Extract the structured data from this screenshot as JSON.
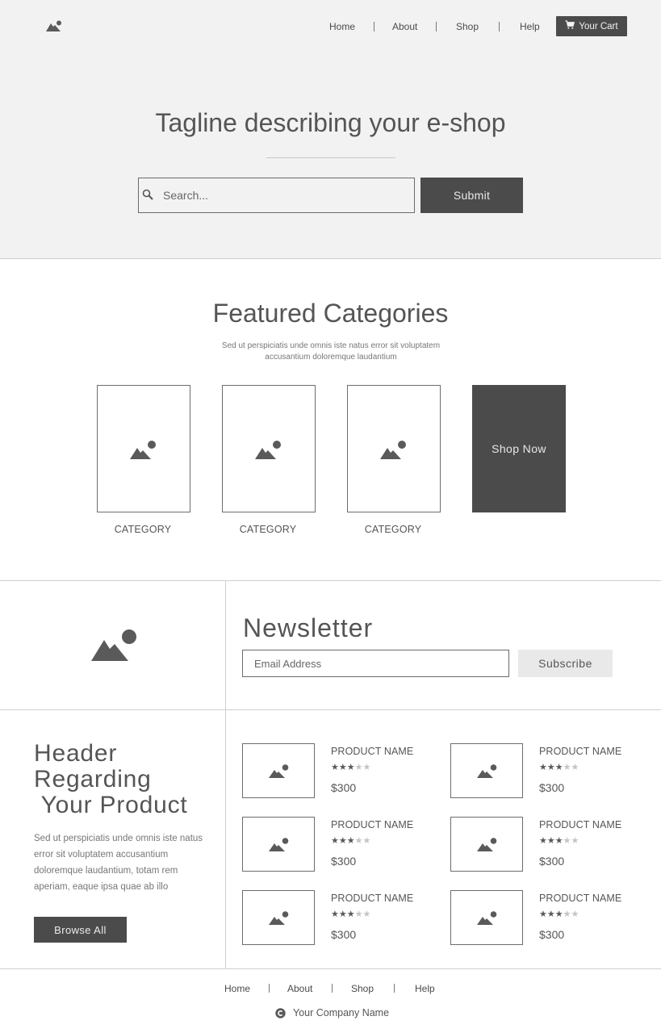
{
  "nav": {
    "items": [
      {
        "label": "Home"
      },
      {
        "label": "About"
      },
      {
        "label": "Shop"
      },
      {
        "label": "Help"
      }
    ],
    "cart_label": "Your Cart"
  },
  "hero": {
    "tagline": "Tagline describing your e-shop",
    "search_placeholder": "Search...",
    "submit_label": "Submit"
  },
  "featured": {
    "title": "Featured Categories",
    "description": "Sed ut perspiciatis unde omnis iste natus error sit voluptatem accusantium doloremque laudantium",
    "categories": [
      {
        "label": "CATEGORY"
      },
      {
        "label": "CATEGORY"
      },
      {
        "label": "CATEGORY"
      }
    ],
    "shop_now_label": "Shop Now"
  },
  "newsletter": {
    "title": "Newsletter",
    "email_placeholder": "Email Address",
    "subscribe_label": "Subscribe"
  },
  "products_section": {
    "header": "Header\nRegarding\n Your Product",
    "description": "Sed ut perspiciatis unde omnis iste natus error sit voluptatem accusantium doloremque laudantium, totam rem aperiam, eaque ipsa quae ab illo",
    "browse_label": "Browse All",
    "products": [
      {
        "name": "PRODUCT NAME",
        "rating": 3,
        "max_rating": 5,
        "price": "$300"
      },
      {
        "name": "PRODUCT NAME",
        "rating": 3,
        "max_rating": 5,
        "price": "$300"
      },
      {
        "name": "PRODUCT NAME",
        "rating": 3,
        "max_rating": 5,
        "price": "$300"
      },
      {
        "name": "PRODUCT NAME",
        "rating": 3,
        "max_rating": 5,
        "price": "$300"
      },
      {
        "name": "PRODUCT NAME",
        "rating": 3,
        "max_rating": 5,
        "price": "$300"
      },
      {
        "name": "PRODUCT NAME",
        "rating": 3,
        "max_rating": 5,
        "price": "$300"
      }
    ]
  },
  "footer": {
    "links": [
      {
        "label": "Home"
      },
      {
        "label": "About"
      },
      {
        "label": "Shop"
      },
      {
        "label": "Help"
      }
    ],
    "company": "Your Company Name",
    "copyright_icon": "copyright-icon"
  },
  "colors": {
    "hero_background": "#f2f2f2",
    "dark_button": "#4b4b4b",
    "light_button": "#e9e9e9",
    "text": "#555555",
    "star_on": "#5a5a5a",
    "star_off": "#c4c4c4"
  }
}
